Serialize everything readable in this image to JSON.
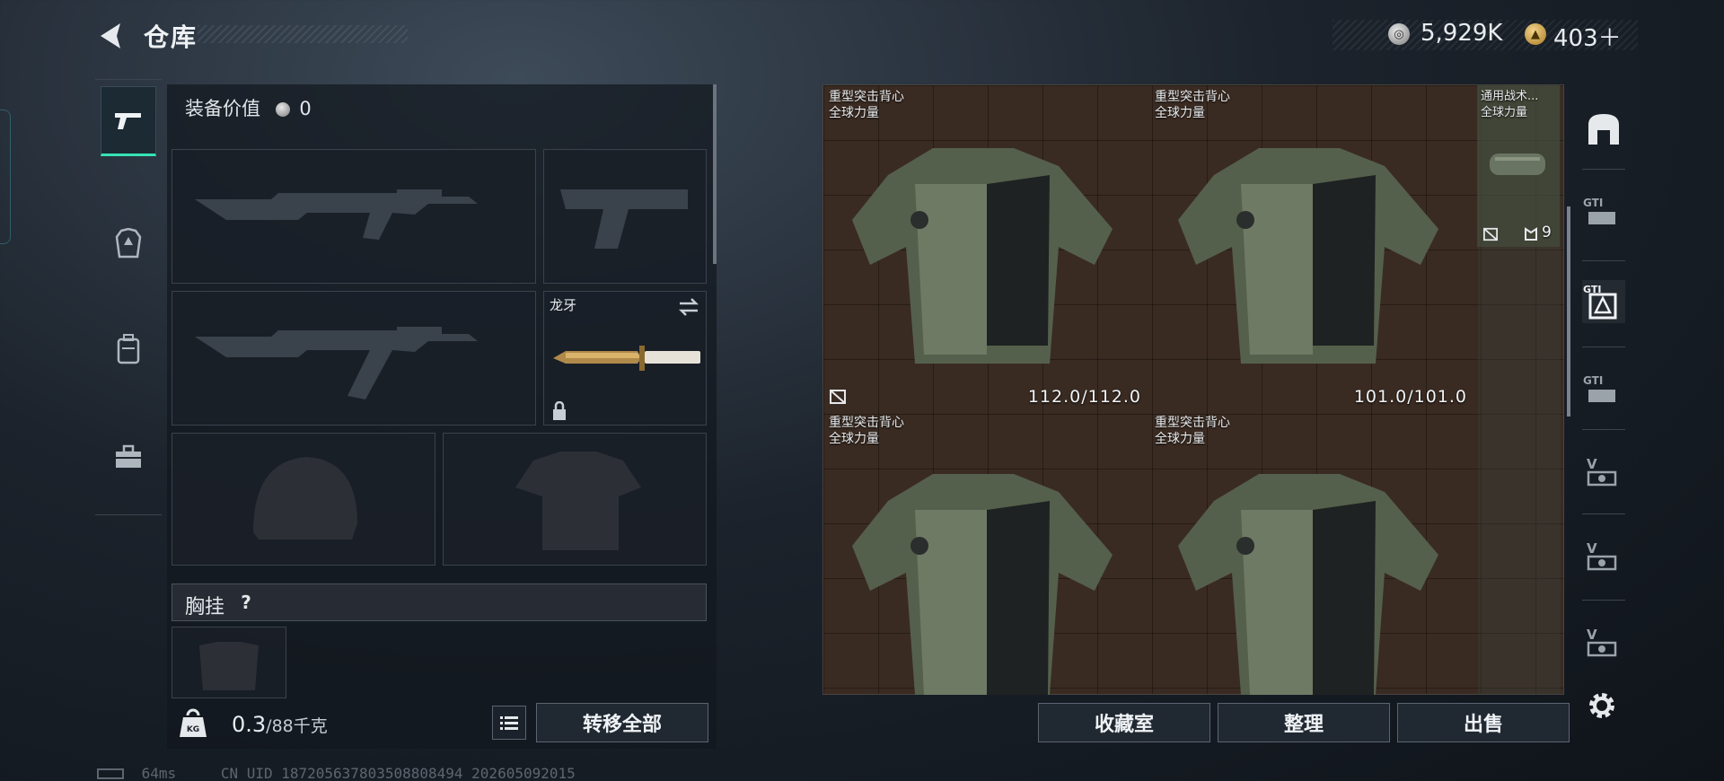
{
  "header": {
    "title": "仓库"
  },
  "currency": {
    "silver": "5,929K",
    "gold": "403＋"
  },
  "loadout": {
    "value_label": "装备价值",
    "value": "0",
    "melee": {
      "name": "龙牙"
    },
    "chest_rig": {
      "label": "胸挂",
      "help": "?"
    }
  },
  "footer": {
    "weight_current": "0.3",
    "weight_max": "/88千克",
    "transfer_all": "转移全部",
    "vault": "收藏室",
    "sort": "整理",
    "sell": "出售"
  },
  "stash": {
    "items": [
      {
        "name": "重型突击背心",
        "brand": "全球力量",
        "durability": "112.0/112.0"
      },
      {
        "name": "重型突击背心",
        "brand": "全球力量",
        "durability": "101.0/101.0"
      },
      {
        "name": "通用战术...",
        "brand": "全球力量",
        "count": "9"
      },
      {
        "name": "重型突击背心",
        "brand": "全球力量"
      },
      {
        "name": "重型突击背心",
        "brand": "全球力量"
      }
    ]
  },
  "status": {
    "ping": "64ms",
    "uid": "CN UID 18720563780350880849​4_202605092015"
  },
  "colors": {
    "accent": "#35e3b4",
    "stash_bg": "#3a2b22"
  }
}
